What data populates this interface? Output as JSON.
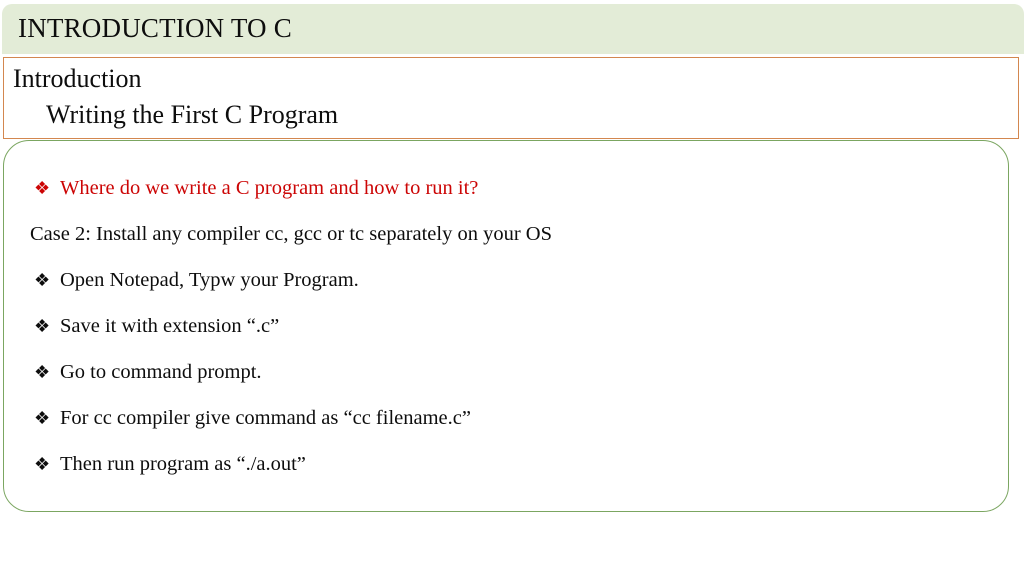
{
  "slide": {
    "title": "INTRODUCTION TO C",
    "subtitle": {
      "heading": "Introduction",
      "subheading": "Writing the First C Program"
    },
    "colors": {
      "banner_bg": "#e3ecd7",
      "subtitle_border": "#d3874f",
      "content_border": "#7ba661",
      "accent_text": "#cc0505",
      "body_text": "#0d0d0d",
      "page_bg": "#ffffff"
    },
    "bullet_glyph": "❖",
    "content": [
      {
        "bullet": true,
        "accent": true,
        "text": "Where do we write a C program and how to run it?"
      },
      {
        "bullet": false,
        "accent": false,
        "text": "Case 2: Install any compiler cc, gcc or tc separately on your OS"
      },
      {
        "bullet": true,
        "accent": false,
        "text": "Open Notepad, Typw your Program."
      },
      {
        "bullet": true,
        "accent": false,
        "text": "Save it with extension “.c”"
      },
      {
        "bullet": true,
        "accent": false,
        "text": "Go to command prompt."
      },
      {
        "bullet": true,
        "accent": false,
        "text": "For cc compiler give command as “cc filename.c”"
      },
      {
        "bullet": true,
        "accent": false,
        "text": "Then run program as “./a.out”"
      }
    ]
  }
}
